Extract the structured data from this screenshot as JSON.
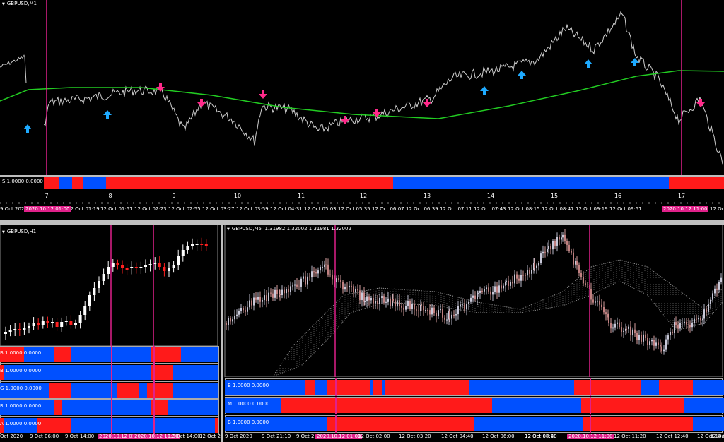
{
  "colors": {
    "bull": "#0050ff",
    "bear": "#ff1a1a",
    "line": "#22cc22",
    "vline": "#e0218a",
    "up_arrow": "#1eaaff",
    "down_arrow": "#ff2a8a"
  },
  "top_chart": {
    "title": "GBPUSD,M1",
    "indicator_label": "S 1.0000 0.0000",
    "day_labels": [
      "7",
      "8",
      "9",
      "10",
      "11",
      "12",
      "13",
      "14",
      "15",
      "16",
      "17"
    ],
    "time_labels": [
      "9 Oct 2020",
      "2020.10.12 01:00",
      "12 Oct 01:19",
      "12 Oct 01:51",
      "12 Oct 02:23",
      "12 Oct 02:55",
      "12 Oct 03:27",
      "12 Oct 03:59",
      "12 Oct 04:31",
      "12 Oct 05:03",
      "12 Oct 05:35",
      "12 Oct 06:07",
      "12 Oct 06:39",
      "12 Oct 07:11",
      "12 Oct 07:43",
      "12 Oct 08:15",
      "12 Oct 08:47",
      "12 Oct 09:19",
      "12 Oct 09:51",
      "2020.10.12 11:00",
      "12 Oc"
    ],
    "highlight_indices": [
      1,
      19
    ],
    "up_arrow_icon": "up-arrow-icon",
    "down_arrow_icon": "down-arrow-icon"
  },
  "left_chart": {
    "title": "GBPUSD,H1",
    "indicator_labels": [
      "B 1.0000 0.0000",
      "B 1.0000 0.0000",
      "G 1.0000 0.0000",
      "R 1.0000 0.0000",
      "A 1.0000 0.0000"
    ],
    "time_labels": [
      "Oct 2020",
      "9 Oct 06:00",
      "9 Oct 14:00",
      "2020.10.12 01:00",
      "2020.10.12 11:00",
      "12 Oct 14:00",
      "12 Oct 2"
    ],
    "highlight_indices": [
      3,
      4
    ]
  },
  "right_chart": {
    "title": "GBPUSD,M5",
    "ohlc": "1.31982 1.32002 1.31981 1.32002",
    "indicator_labels": [
      "B 1.0000 0.0000",
      "M 1.0000 0.0000",
      "B 1.0000 0.0000"
    ],
    "time_labels": [
      "9 Oct 2020",
      "9 Oct 21:10",
      "9 Oct 22:",
      "2020.10.12 01:00",
      "12 Oct 02:00",
      "12 Oct 03:20",
      "12 Oct 04:40",
      "12 Oct 06:00",
      "12 Oct 07:20",
      "12 Oct 08:40",
      "2020.10.12 11:00",
      "12 Oct 11:20",
      "12 Oct 12:40",
      "12 Oct 14:00",
      "12 Oct 15:"
    ],
    "highlight_indices": [
      3,
      10
    ]
  }
}
